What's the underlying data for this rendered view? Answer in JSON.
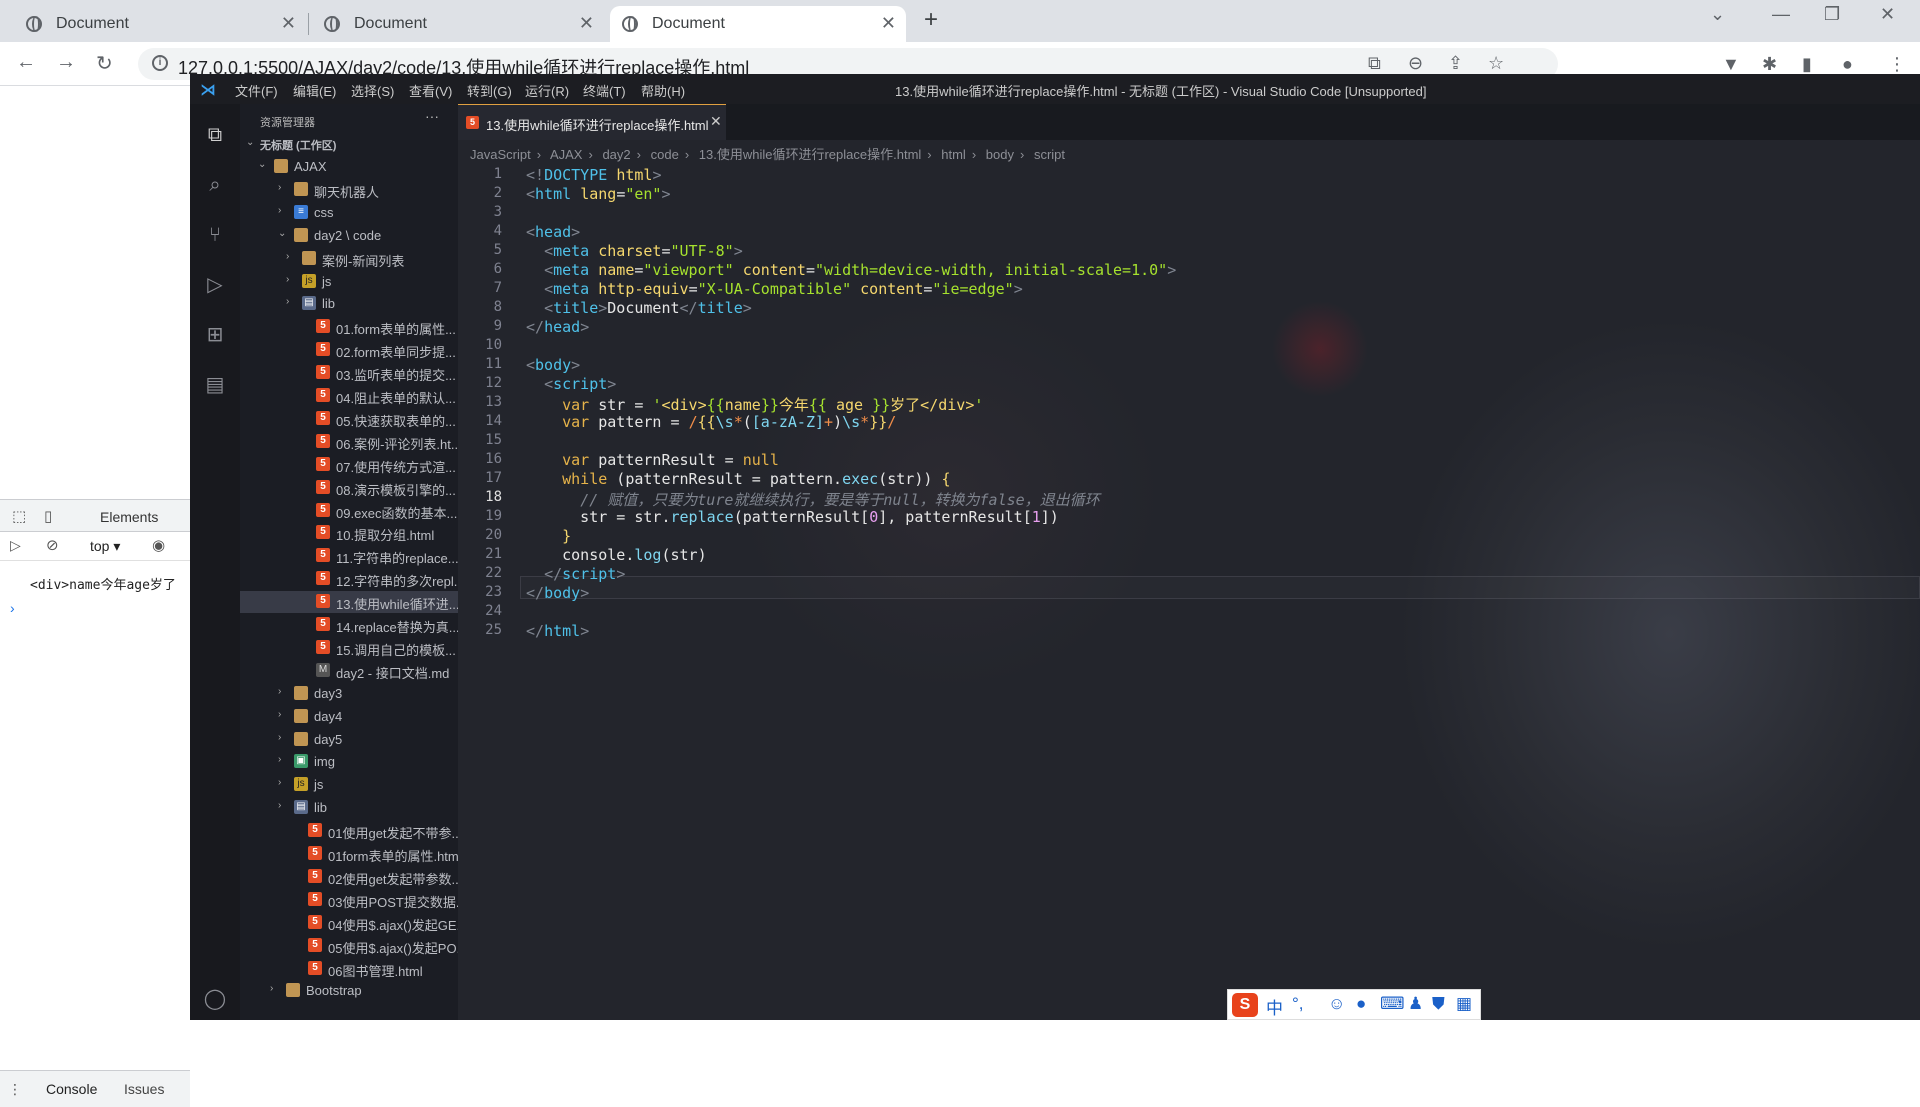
{
  "browser": {
    "tabs": [
      {
        "title": "Document"
      },
      {
        "title": "Document"
      },
      {
        "title": "Document"
      }
    ],
    "url": "127.0.0.1:5500/AJAX/day2/code/13.使用while循环进行replace操作.html"
  },
  "devtools": {
    "tab_elements": "Elements",
    "context": "top",
    "log_line": "<div>name今年age岁了",
    "prompt": "›",
    "bottom_tabs": [
      "Console",
      "Issues"
    ]
  },
  "vscode": {
    "menus": [
      "文件(F)",
      "编辑(E)",
      "选择(S)",
      "查看(V)",
      "转到(G)",
      "运行(R)",
      "终端(T)",
      "帮助(H)"
    ],
    "window_title": "13.使用while循环进行replace操作.html - 无标题 (工作区) - Visual Studio Code [Unsupported]",
    "explorer": {
      "title": "资源管理器",
      "workspace": "无标题 (工作区)",
      "items": [
        {
          "label": "AJAX"
        },
        {
          "label": "聊天机器人"
        },
        {
          "label": "css"
        },
        {
          "label": "day2 \\ code"
        },
        {
          "label": "案例-新闻列表"
        },
        {
          "label": "js"
        },
        {
          "label": "lib"
        },
        {
          "label": "01.form表单的属性..."
        },
        {
          "label": "02.form表单同步提..."
        },
        {
          "label": "03.监听表单的提交..."
        },
        {
          "label": "04.阻止表单的默认..."
        },
        {
          "label": "05.快速获取表单的..."
        },
        {
          "label": "06.案例-评论列表.ht..."
        },
        {
          "label": "07.使用传统方式渲..."
        },
        {
          "label": "08.演示模板引擎的..."
        },
        {
          "label": "09.exec函数的基本..."
        },
        {
          "label": "10.提取分组.html"
        },
        {
          "label": "11.字符串的replace..."
        },
        {
          "label": "12.字符串的多次repl..."
        },
        {
          "label": "13.使用while循环进..."
        },
        {
          "label": "14.replace替换为真..."
        },
        {
          "label": "15.调用自己的模板..."
        },
        {
          "label": "day2 - 接口文档.md"
        },
        {
          "label": "day3"
        },
        {
          "label": "day4"
        },
        {
          "label": "day5"
        },
        {
          "label": "img"
        },
        {
          "label": "js"
        },
        {
          "label": "lib"
        },
        {
          "label": "01使用get发起不带参..."
        },
        {
          "label": "01form表单的属性.html"
        },
        {
          "label": "02使用get发起带参数..."
        },
        {
          "label": "03使用POST提交数据..."
        },
        {
          "label": "04使用$.ajax()发起GE..."
        },
        {
          "label": "05使用$.ajax()发起PO..."
        },
        {
          "label": "06图书管理.html"
        },
        {
          "label": "Bootstrap"
        }
      ]
    },
    "editor_tab": "13.使用while循环进行replace操作.html",
    "breadcrumbs": [
      "JavaScript",
      "AJAX",
      "day2",
      "code",
      "13.使用while循环进行replace操作.html",
      "html",
      "body",
      "script"
    ],
    "line_numbers": [
      "1",
      "2",
      "3",
      "4",
      "5",
      "6",
      "7",
      "8",
      "9",
      "10",
      "11",
      "12",
      "13",
      "14",
      "15",
      "16",
      "17",
      "18",
      "19",
      "20",
      "21",
      "22",
      "23",
      "24",
      "25"
    ],
    "ime": [
      "中",
      "°,",
      "☺",
      "🎤",
      "⌨",
      "👕",
      "▦"
    ]
  }
}
